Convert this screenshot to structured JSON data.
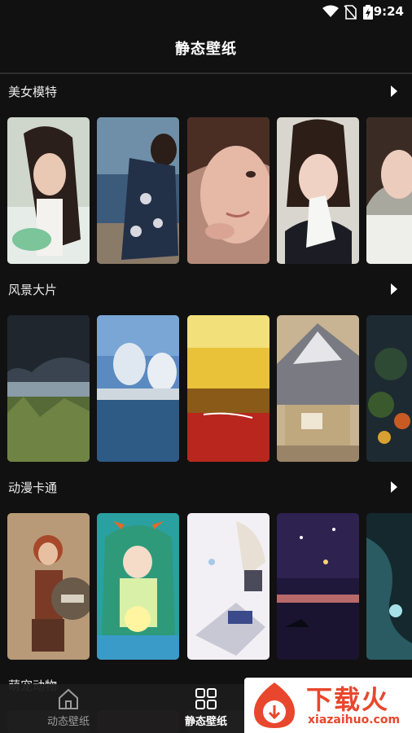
{
  "status_bar": {
    "time": "9:24"
  },
  "header": {
    "title": "静态壁纸"
  },
  "sections": [
    {
      "name": "美女模特",
      "thumb_count": 5
    },
    {
      "name": "风景大片",
      "thumb_count": 5
    },
    {
      "name": "动漫卡通",
      "thumb_count": 5
    },
    {
      "name": "萌宠动物",
      "thumb_count": 5
    }
  ],
  "bottom_nav": {
    "dynamic_label": "动态壁纸",
    "static_label": "静态壁纸",
    "active": "static"
  },
  "watermark": {
    "title": "下载火",
    "url": "xiazaihuo.com"
  },
  "colors": {
    "background": "#111111",
    "accent": "#e8472d"
  }
}
